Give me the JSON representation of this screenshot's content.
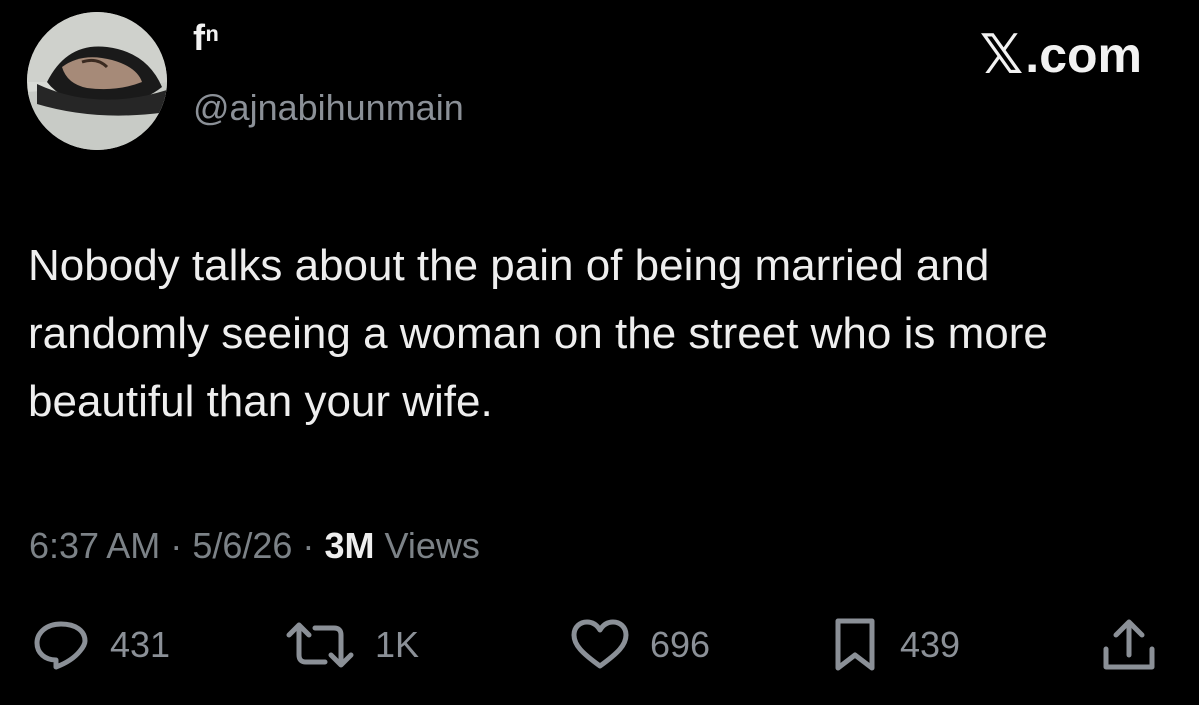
{
  "author": {
    "display_name": "fⁿ",
    "handle": "@ajnabihunmain"
  },
  "site": {
    "logo_mark": "𝕏",
    "logo_text": ".com"
  },
  "tweet": {
    "text": "Nobody talks about the pain of being married and randomly seeing a woman on the street who is more beautiful than your wife."
  },
  "meta": {
    "time": "6:37 AM",
    "separator": "·",
    "date": "5/6/26",
    "views_count": "3M",
    "views_label": "Views"
  },
  "actions": {
    "replies": "431",
    "reposts": "1K",
    "likes": "696",
    "bookmarks": "439"
  },
  "icons": {
    "reply": "speech-bubble-icon",
    "repost": "repost-arrows-icon",
    "like": "heart-icon",
    "bookmark": "bookmark-icon",
    "share": "share-upload-icon"
  },
  "colors": {
    "background": "#000000",
    "text": "#e7e9ea",
    "muted": "#8b9097"
  }
}
